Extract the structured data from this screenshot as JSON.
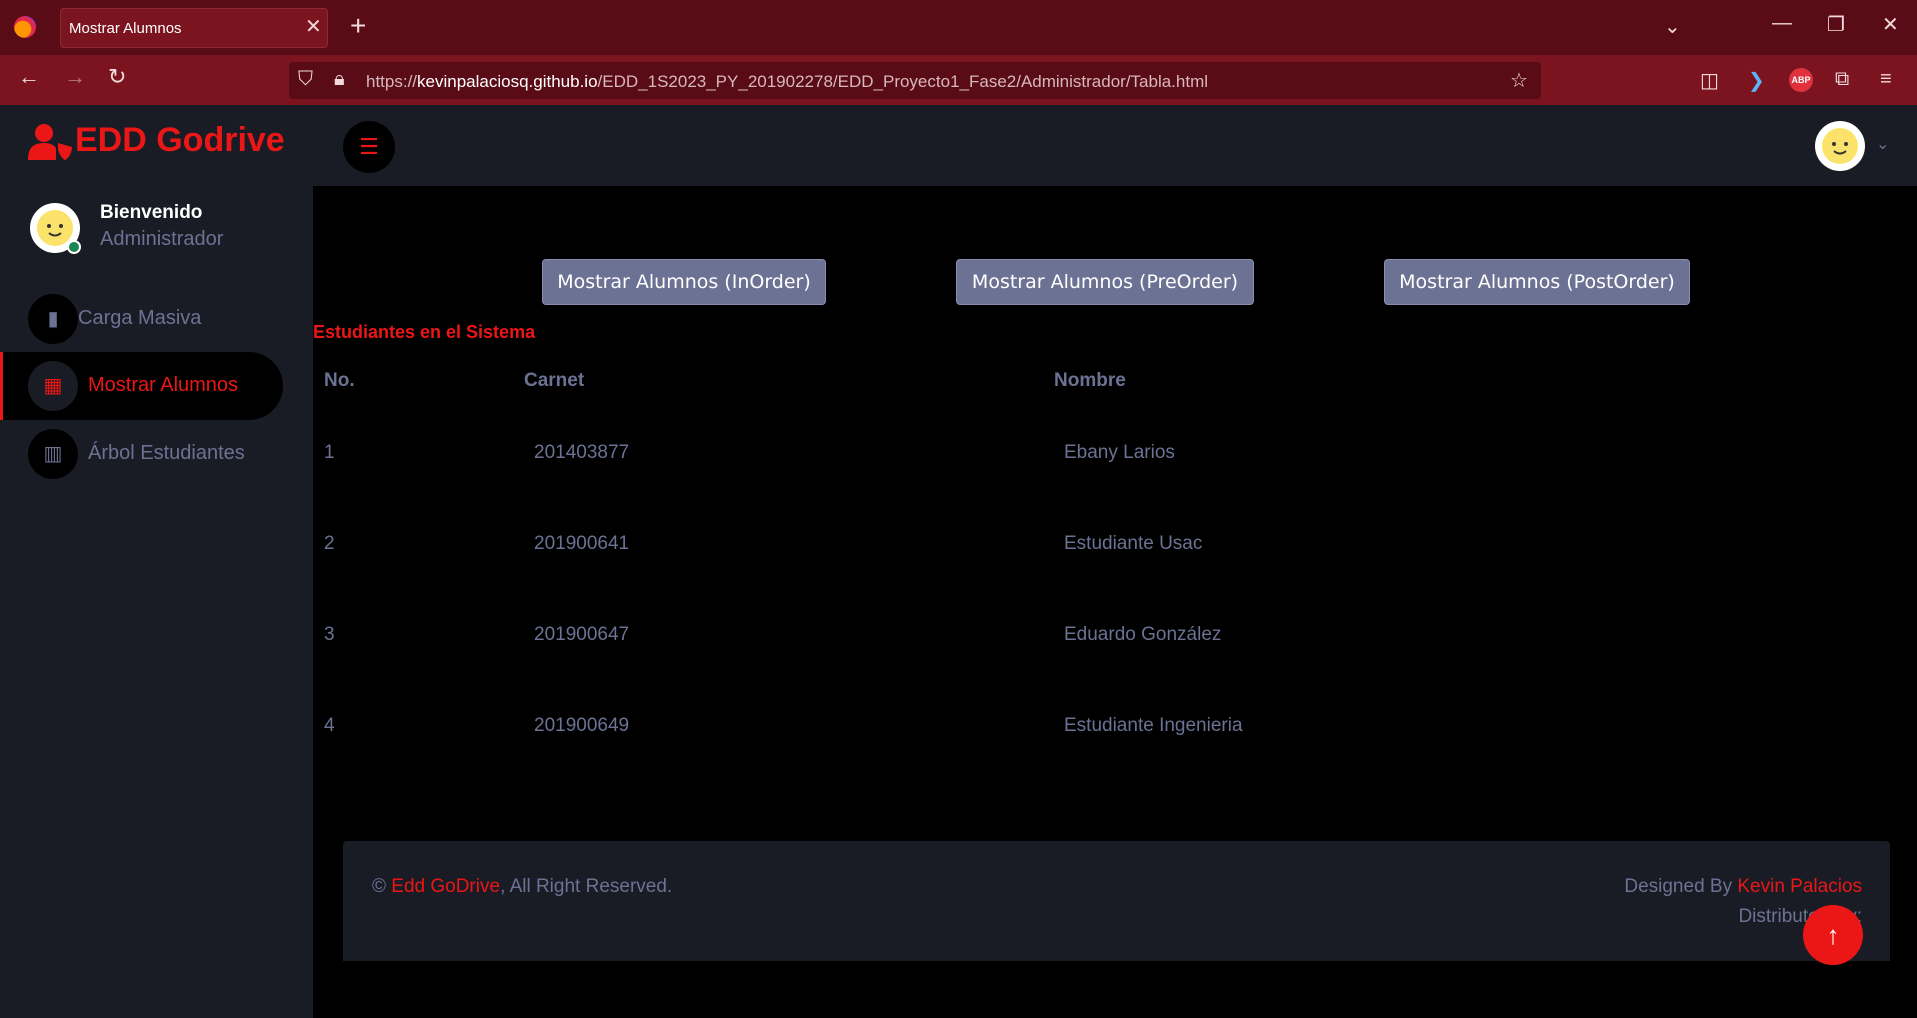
{
  "browser": {
    "tab_title": "Mostrar Alumnos",
    "tab_close": "✕",
    "new_tab": "+",
    "url_prefix": "https://",
    "url_host": "kevinpalaciosq.github.io",
    "url_path": "/EDD_1S2023_PY_201902278/EDD_Proyecto1_Fase2/Administrador/Tabla.html",
    "extension_abp": "ABP"
  },
  "app": {
    "brand": "EDD Godrive",
    "accent_color": "#eb1616",
    "menu_icon": "bars-icon"
  },
  "sidebar": {
    "welcome": "Bienvenido",
    "role": "Administrador",
    "items": [
      {
        "label": "Carga Masiva",
        "icon": "file-icon",
        "active": false
      },
      {
        "label": "Mostrar Alumnos",
        "icon": "table-icon",
        "active": true
      },
      {
        "label": "Árbol Estudiantes",
        "icon": "chart-bar-icon",
        "active": false
      }
    ]
  },
  "main": {
    "buttons": [
      "Mostrar Alumnos (InOrder)",
      "Mostrar Alumnos (PreOrder)",
      "Mostrar Alumnos (PostOrder)"
    ],
    "section_title": "Estudiantes en el Sistema",
    "table": {
      "headers": [
        "No.",
        "Carnet",
        "Nombre"
      ],
      "rows": [
        [
          "1",
          "201403877",
          "Ebany Larios"
        ],
        [
          "2",
          "201900641",
          "Estudiante Usac"
        ],
        [
          "3",
          "201900647",
          "Eduardo González"
        ],
        [
          "4",
          "201900649",
          "Estudiante Ingenieria"
        ]
      ]
    }
  },
  "footer": {
    "copyright_symbol": "©",
    "site_link": "Edd GoDrive",
    "rights": ", All Right Reserved.",
    "designed_by": "Designed By",
    "designer_link": "Kevin Palacios",
    "distributed_by": "Distributed By:"
  }
}
